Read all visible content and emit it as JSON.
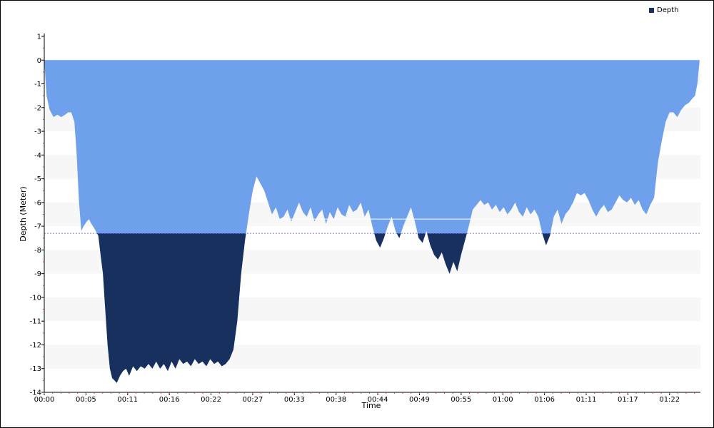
{
  "chart_data": {
    "type": "area",
    "title": "",
    "xlabel": "Time",
    "ylabel": "Depth (Meter)",
    "legend": {
      "label": "Depth",
      "position": "top-right"
    },
    "ylim": [
      -14,
      1
    ],
    "yticks": [
      1,
      0,
      -1,
      -2,
      -3,
      -4,
      -5,
      -6,
      -7,
      -8,
      -9,
      -10,
      -11,
      -12,
      -13,
      -14
    ],
    "xlim_minutes": [
      0,
      85
    ],
    "xticks": [
      "00:00",
      "00:05",
      "00:11",
      "00:16",
      "00:22",
      "00:27",
      "00:33",
      "00:38",
      "00:44",
      "00:49",
      "00:55",
      "01:00",
      "01:06",
      "01:11",
      "01:17",
      "01:22"
    ],
    "xtick_minutes": [
      0,
      5.4,
      10.8,
      16.2,
      21.6,
      27.0,
      32.4,
      37.8,
      43.2,
      48.6,
      54.0,
      59.4,
      64.8,
      70.2,
      75.6,
      81.0
    ],
    "reference_lines": [
      {
        "depth": -7.3,
        "style": "dotted"
      },
      {
        "depth": -6.7,
        "style": "solid",
        "x_from_minutes": 29.6,
        "x_to_minutes": 63.8
      }
    ],
    "threshold_depth": -7.3,
    "colors": {
      "shallow": "#6fa0ec",
      "deep": "#17305e",
      "reference": "#7777ff",
      "grid_band": "#f7f7f7"
    },
    "series": [
      {
        "name": "Depth",
        "time_minutes": [
          0,
          0.3,
          0.7,
          1.2,
          1.7,
          2.2,
          2.7,
          3.1,
          3.5,
          3.9,
          4.2,
          4.5,
          4.8,
          5.1,
          5.5,
          5.8,
          6.1,
          6.5,
          7.0,
          7.3,
          7.6,
          7.8,
          8.0,
          8.2,
          8.5,
          8.8,
          9.1,
          9.4,
          9.8,
          10.2,
          10.6,
          11.0,
          11.5,
          12.0,
          12.5,
          13.0,
          13.5,
          14.0,
          14.5,
          15.0,
          15.5,
          16.0,
          16.5,
          17.0,
          17.5,
          18.0,
          18.5,
          19.0,
          19.5,
          20.0,
          20.5,
          21.0,
          21.5,
          22.0,
          22.5,
          23.0,
          23.5,
          24.0,
          24.5,
          25.0,
          25.5,
          26.0,
          26.5,
          27.0,
          27.5,
          28.0,
          28.5,
          29.0,
          29.5,
          30.0,
          30.5,
          31.0,
          31.5,
          32.0,
          32.5,
          33.0,
          33.5,
          34.0,
          34.5,
          35.0,
          35.5,
          36.0,
          36.5,
          37.0,
          37.5,
          38.0,
          38.5,
          39.0,
          39.5,
          40.0,
          40.5,
          41.0,
          41.5,
          42.0,
          42.5,
          43.0,
          43.5,
          44.0,
          44.5,
          45.0,
          45.5,
          46.0,
          46.5,
          47.0,
          47.5,
          48.0,
          48.5,
          49.0,
          49.5,
          50.0,
          50.5,
          51.0,
          51.5,
          52.0,
          52.5,
          53.0,
          53.5,
          54.0,
          54.5,
          55.0,
          55.5,
          56.0,
          56.5,
          57.0,
          57.5,
          58.0,
          58.5,
          59.0,
          59.5,
          60.0,
          60.5,
          61.0,
          61.5,
          62.0,
          62.5,
          63.0,
          63.5,
          64.0,
          64.5,
          65.0,
          65.5,
          66.0,
          66.5,
          67.0,
          67.5,
          68.0,
          68.5,
          69.0,
          69.5,
          70.0,
          70.5,
          71.0,
          71.5,
          72.0,
          72.5,
          73.0,
          73.5,
          74.0,
          74.5,
          75.0,
          75.5,
          76.0,
          76.5,
          77.0,
          77.5,
          78.0,
          78.5,
          79.0,
          79.5,
          80.0,
          80.5,
          81.0,
          81.5,
          82.0,
          82.5,
          83.0,
          83.5,
          84.0,
          84.3,
          84.6,
          84.9,
          85.0
        ],
        "depth": [
          0,
          -1.5,
          -2.1,
          -2.4,
          -2.3,
          -2.4,
          -2.3,
          -2.2,
          -2.2,
          -2.6,
          -4.0,
          -6.0,
          -7.2,
          -7.0,
          -6.8,
          -6.7,
          -6.9,
          -7.1,
          -7.4,
          -8.2,
          -9.0,
          -10.0,
          -11.0,
          -12.0,
          -13.0,
          -13.4,
          -13.5,
          -13.6,
          -13.3,
          -13.1,
          -13.0,
          -13.3,
          -12.9,
          -13.1,
          -12.9,
          -13.0,
          -12.8,
          -13.0,
          -12.7,
          -13.0,
          -12.8,
          -13.1,
          -12.7,
          -13.0,
          -12.6,
          -12.8,
          -12.7,
          -12.9,
          -12.6,
          -12.8,
          -12.7,
          -12.9,
          -12.6,
          -12.8,
          -12.7,
          -12.9,
          -12.8,
          -12.6,
          -12.2,
          -11.0,
          -9.0,
          -7.6,
          -6.5,
          -5.5,
          -4.9,
          -5.2,
          -5.5,
          -6.0,
          -6.5,
          -6.2,
          -6.7,
          -6.6,
          -6.3,
          -6.8,
          -6.4,
          -6.0,
          -6.4,
          -6.6,
          -6.2,
          -6.8,
          -6.5,
          -6.3,
          -6.9,
          -6.4,
          -6.7,
          -6.2,
          -6.5,
          -6.6,
          -6.1,
          -6.4,
          -6.3,
          -6.0,
          -6.6,
          -6.3,
          -7.0,
          -7.6,
          -7.9,
          -7.5,
          -7.0,
          -6.6,
          -7.2,
          -7.5,
          -7.0,
          -6.6,
          -6.2,
          -6.8,
          -7.5,
          -7.7,
          -7.2,
          -7.8,
          -8.2,
          -8.4,
          -8.1,
          -8.6,
          -9.0,
          -8.5,
          -8.9,
          -8.2,
          -7.6,
          -7.0,
          -6.3,
          -6.1,
          -5.9,
          -6.1,
          -6.0,
          -6.3,
          -6.1,
          -6.4,
          -6.2,
          -6.5,
          -6.3,
          -6.0,
          -6.4,
          -6.6,
          -6.2,
          -6.5,
          -6.3,
          -6.6,
          -7.3,
          -7.8,
          -7.4,
          -6.6,
          -6.3,
          -6.9,
          -6.5,
          -6.3,
          -6.0,
          -5.6,
          -5.7,
          -5.6,
          -5.9,
          -6.3,
          -6.6,
          -6.3,
          -6.1,
          -6.4,
          -6.3,
          -6.0,
          -5.7,
          -5.9,
          -6.0,
          -5.8,
          -6.1,
          -5.9,
          -6.3,
          -6.5,
          -6.1,
          -5.8,
          -4.3,
          -3.4,
          -2.6,
          -2.2,
          -2.2,
          -2.4,
          -2.1,
          -1.9,
          -1.8,
          -1.6,
          -1.5,
          -1.0,
          0
        ]
      }
    ]
  }
}
